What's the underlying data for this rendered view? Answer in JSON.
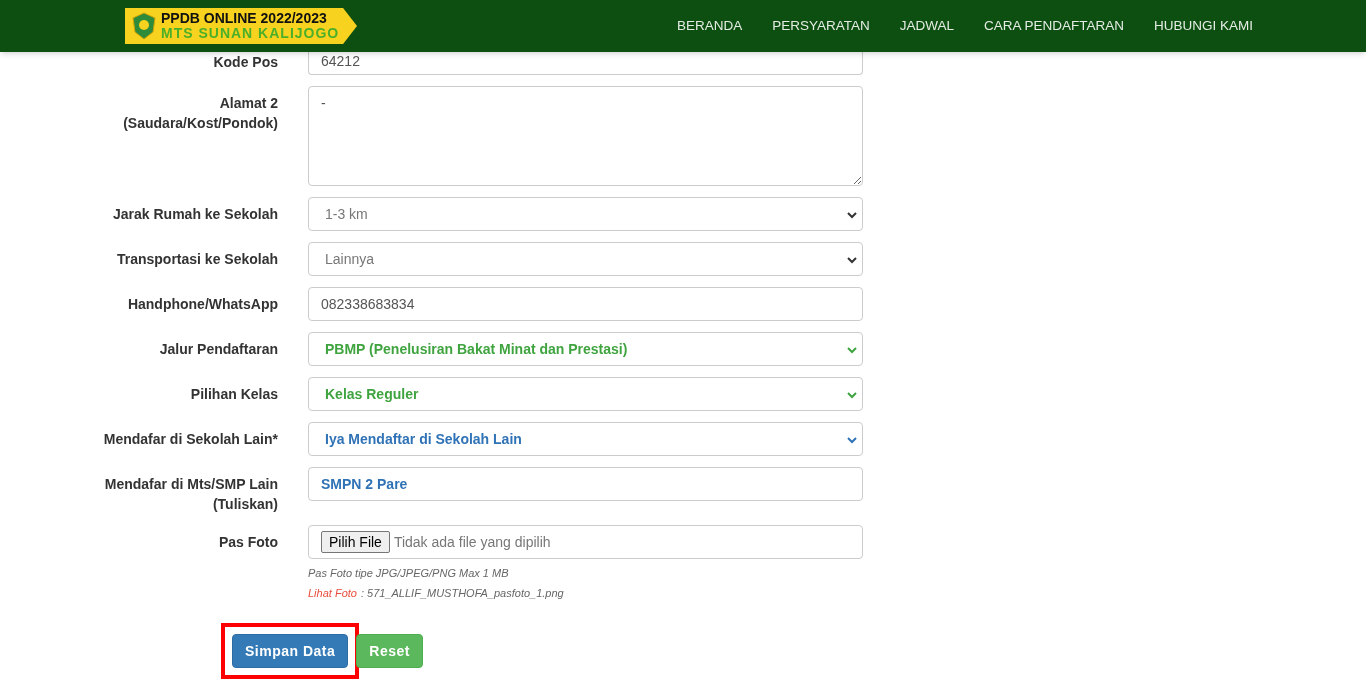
{
  "header": {
    "logo": {
      "line1": "PPDB ONLINE 2022/2023",
      "line2": "MTS SUNAN KALIJOGO"
    },
    "nav": [
      "BERANDA",
      "PERSYARATAN",
      "JADWAL",
      "CARA PENDAFTARAN",
      "HUBUNGI KAMI"
    ]
  },
  "form": {
    "fields": [
      {
        "kind": "partial_text",
        "label": "Kode Pos",
        "value": "64212",
        "color": "#555555"
      },
      {
        "kind": "textarea",
        "label": "Alamat 2 (Saudara/Kost/Pondok)",
        "value": "-",
        "color": "#555555"
      },
      {
        "kind": "select",
        "label": "Jarak Rumah ke Sekolah",
        "value": "1-3 km",
        "color": "#777777"
      },
      {
        "kind": "select",
        "label": "Transportasi ke Sekolah",
        "value": "Lainnya",
        "color": "#777777"
      },
      {
        "kind": "text",
        "label": "Handphone/WhatsApp",
        "value": "082338683834",
        "color": "#555555"
      },
      {
        "kind": "select",
        "label": "Jalur Pendaftaran",
        "value": "PBMP (Penelusiran Bakat Minat dan Prestasi)",
        "color": "#3fa43f"
      },
      {
        "kind": "select",
        "label": "Pilihan Kelas",
        "value": "Kelas Reguler",
        "color": "#3fa43f"
      },
      {
        "kind": "select",
        "label": "Mendafar di Sekolah Lain*",
        "value": "Iya Mendaftar di Sekolah Lain",
        "color": "#2f72b6"
      },
      {
        "kind": "text",
        "label": "Mendafar di Mts/SMP Lain (Tuliskan)",
        "value": "SMPN 2 Pare",
        "color": "#2f72b6"
      },
      {
        "kind": "file",
        "label": "Pas Foto",
        "button": "Pilih File",
        "status": "Tidak ada file yang dipilih",
        "hint": "Pas Foto tipe JPG/JPEG/PNG Max 1 MB",
        "link": "Lihat Foto",
        "filename": ": 571_ALLIF_MUSTHOFA_pasfoto_1.png"
      }
    ]
  },
  "buttons": [
    {
      "label": "Simpan Data",
      "kind": "primary",
      "highlighted": true
    },
    {
      "label": "Reset",
      "kind": "success",
      "highlighted": false
    }
  ]
}
